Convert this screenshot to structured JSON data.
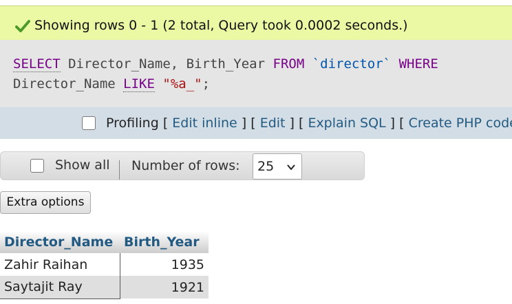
{
  "message": {
    "text": "Showing rows 0 - 1 (2 total, Query took 0.0002 seconds.)",
    "status_color": "#ebf8a4"
  },
  "sql": {
    "kw_select": "SELECT",
    "columns": " Director_Name, Birth_Year ",
    "kw_from": "FROM",
    "table": "`director`",
    "kw_where": "WHERE",
    "where_col": "Director_Name ",
    "kw_like": "LIKE",
    "pattern": "\"%a_\"",
    "end": ";"
  },
  "profiling": {
    "label": "Profiling",
    "links": [
      "Edit inline",
      "Edit",
      "Explain SQL",
      "Create PHP code"
    ]
  },
  "navigation": {
    "show_all_label": "Show all",
    "rows_label": "Number of rows:",
    "rows_value": "25"
  },
  "extra_options_label": "Extra options",
  "results": {
    "columns": [
      "Director_Name",
      "Birth_Year"
    ],
    "rows": [
      {
        "Director_Name": "Zahir Raihan",
        "Birth_Year": "1935"
      },
      {
        "Director_Name": "Saytajit Ray",
        "Birth_Year": "1921"
      }
    ]
  }
}
